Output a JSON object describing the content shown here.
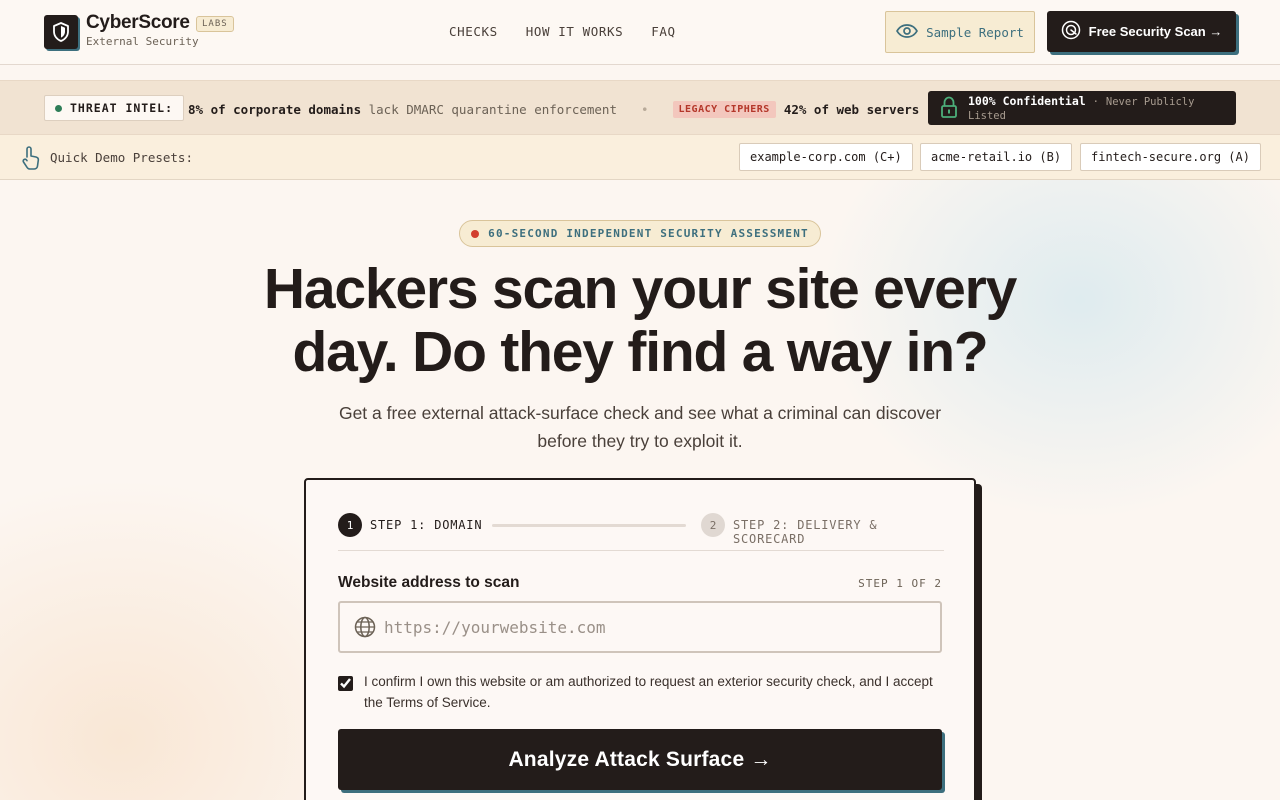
{
  "brand": {
    "name": "CyberScore",
    "badge": "LABS",
    "subtitle": "External Security"
  },
  "nav": {
    "items": [
      "CHECKS",
      "HOW IT WORKS",
      "FAQ"
    ]
  },
  "header_actions": {
    "sample_report": "Sample Report",
    "free_scan": "Free Security Scan →"
  },
  "threat_strip": {
    "label": "THREAT INTEL:",
    "item1_stat": "8% of corporate domains",
    "item1_text": "lack DMARC quarantine enforcement",
    "separator": "•",
    "item2_tag": "LEGACY CIPHERS",
    "item2_stat": "42% of web servers",
    "confidential_bold": "100% Confidential",
    "confidential_sep": "·",
    "confidential_muted": "Never Publicly Listed"
  },
  "presets": {
    "label": "Quick Demo Presets:",
    "items": [
      "example-corp.com (C+)",
      "acme-retail.io (B)",
      "fintech-secure.org (A)"
    ]
  },
  "hero": {
    "pill": "60-SECOND INDEPENDENT SECURITY ASSESSMENT",
    "title_line1": "Hackers scan your site every",
    "title_line2": "day. Do they find a way in?",
    "subtitle_line1": "Get a free external attack-surface check and see what a criminal can discover",
    "subtitle_line2": "before they try to exploit it."
  },
  "form": {
    "step1_number": "1",
    "step1_label": "STEP 1: DOMAIN",
    "step2_number": "2",
    "step2_label": "STEP 2: DELIVERY & SCORECARD",
    "field_label": "Website address to scan",
    "step_count": "STEP 1 OF 2",
    "url_placeholder": "https://yourwebsite.com",
    "url_value": "",
    "confirm_text": "I confirm I own this website or am authorized to request an exterior security check, and I accept the Terms of Service.",
    "confirm_checked": true,
    "submit_label": "Analyze Attack Surface →"
  },
  "colors": {
    "ink": "#231c1a",
    "teal": "#3d6f7e",
    "cream": "#fcf6f1",
    "alert_red": "#d23f2f",
    "ok_green": "#2e7d58"
  }
}
